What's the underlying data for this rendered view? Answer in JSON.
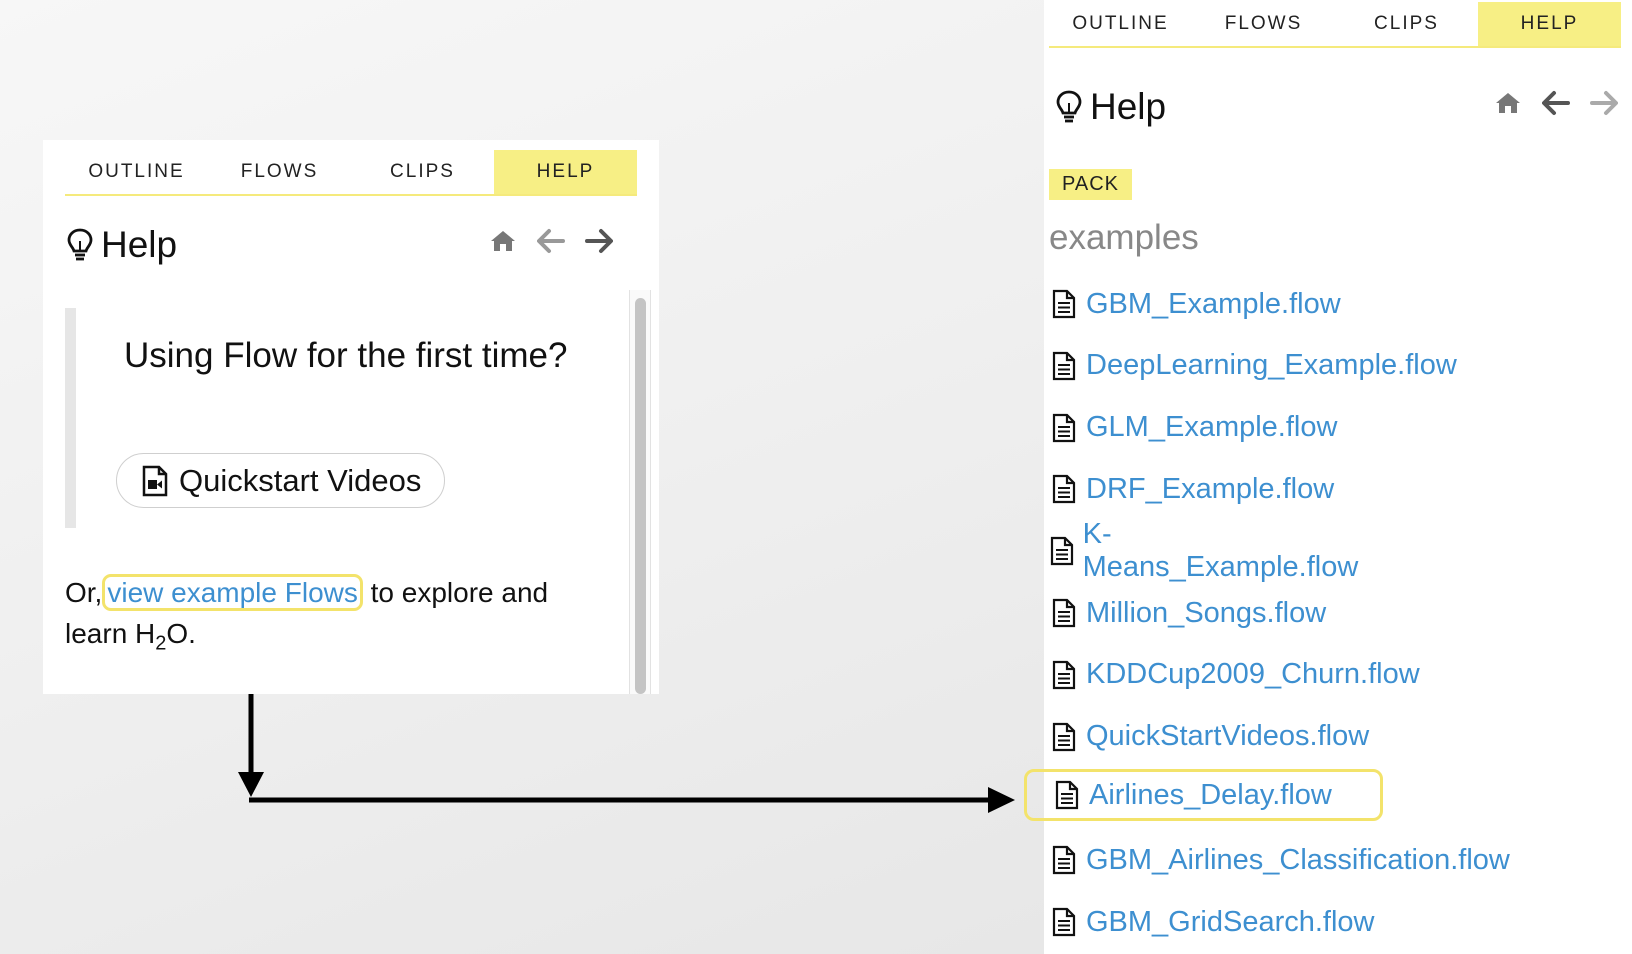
{
  "left_panel": {
    "tabs": [
      "OUTLINE",
      "FLOWS",
      "CLIPS",
      "HELP"
    ],
    "active_tab": "HELP",
    "title": "Help",
    "intro_heading": "Using Flow for the first time?",
    "quickstart_button": "Quickstart Videos",
    "text_prefix": "Or,",
    "example_link": "view example Flows",
    "text_suffix": "to explore and learn H",
    "text_subscript": "2",
    "text_end": "O."
  },
  "right_panel": {
    "tabs": [
      "OUTLINE",
      "FLOWS",
      "CLIPS",
      "HELP"
    ],
    "active_tab": "HELP",
    "title": "Help",
    "badge": "PACK",
    "section_heading": "examples",
    "flows": [
      "GBM_Example.flow",
      "DeepLearning_Example.flow",
      "GLM_Example.flow",
      "DRF_Example.flow",
      "K-Means_Example.flow",
      "Million_Songs.flow",
      "KDDCup2009_Churn.flow",
      "QuickStartVideos.flow",
      "Airlines_Delay.flow",
      "GBM_Airlines_Classification.flow",
      "GBM_GridSearch.flow"
    ],
    "highlighted_flow": "Airlines_Delay.flow"
  },
  "colors": {
    "accent_yellow": "#f7ef85",
    "highlight_border": "#f3e36b",
    "link_blue": "#3d8fd0"
  }
}
